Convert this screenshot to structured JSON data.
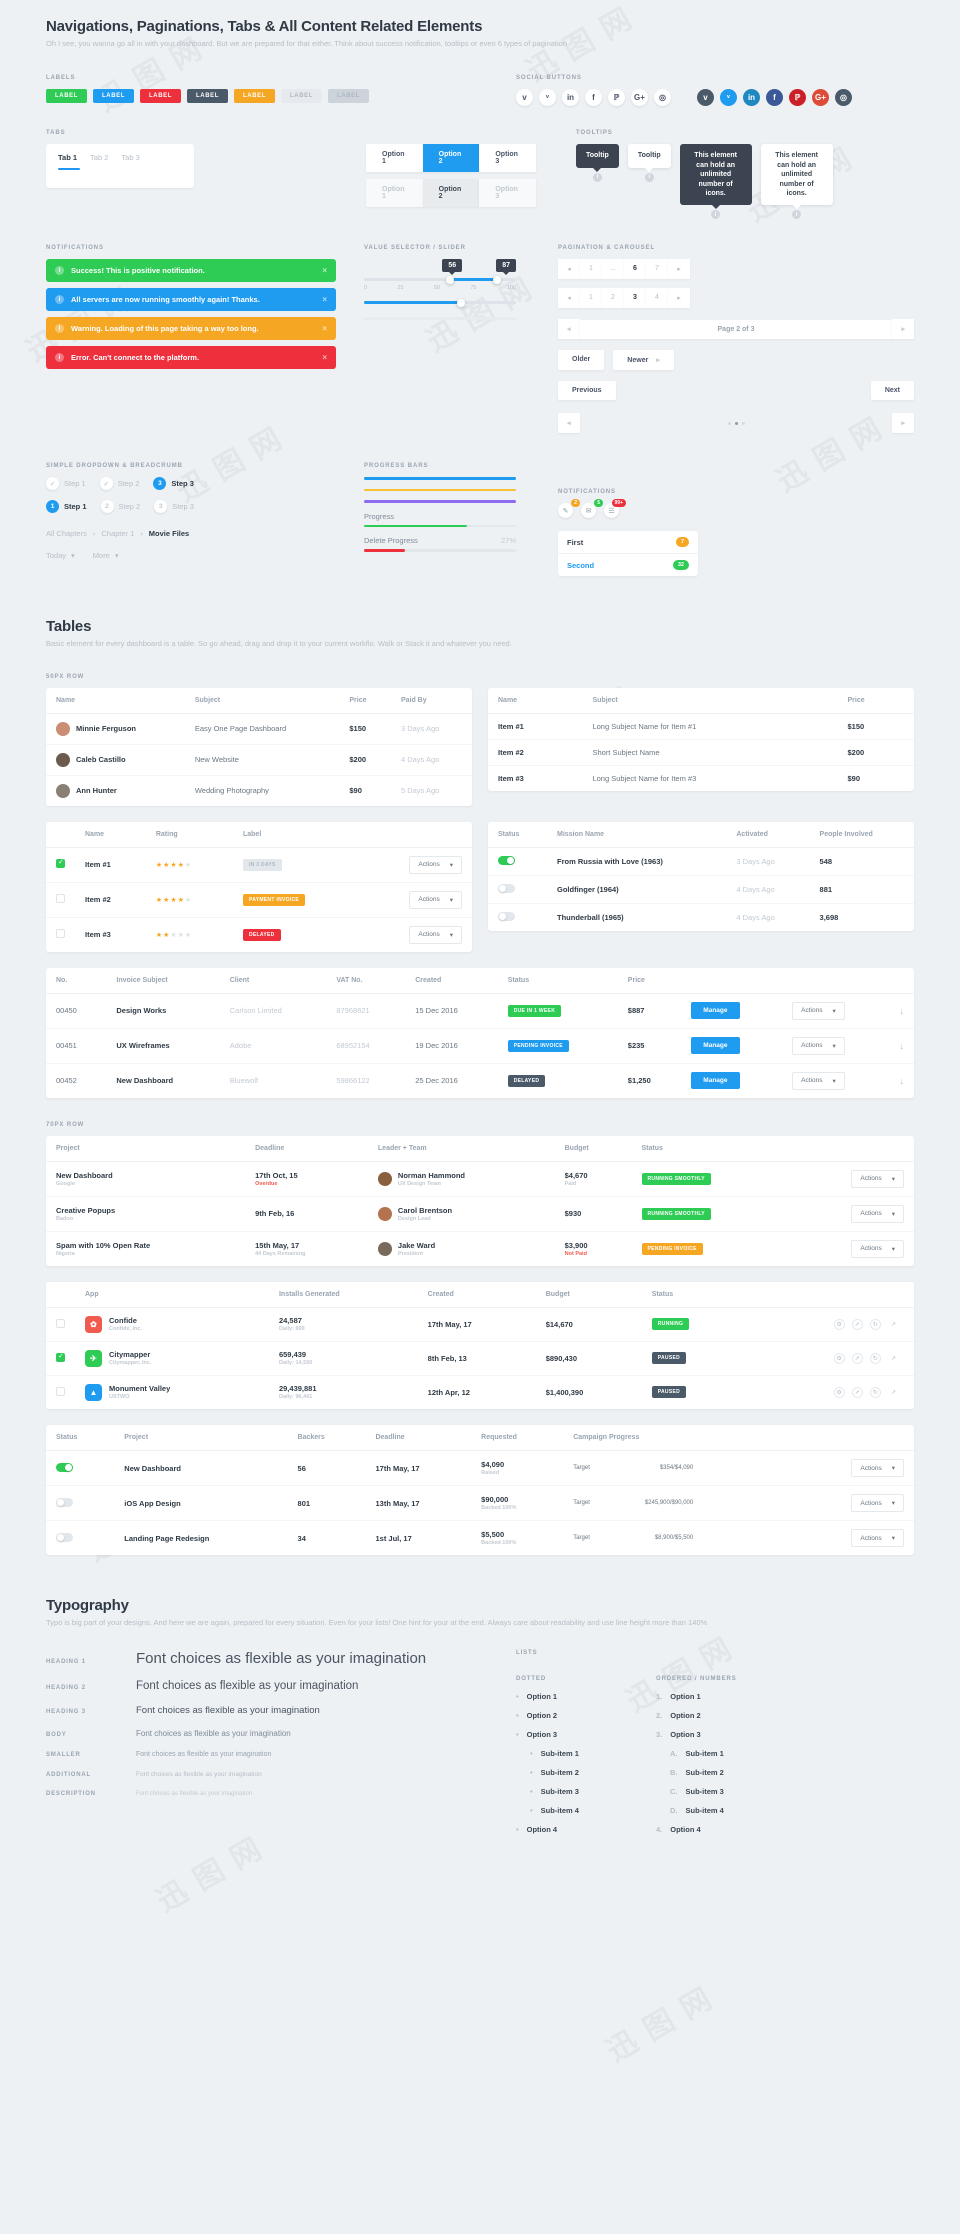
{
  "header": {
    "title": "Navigations, Paginations, Tabs & All Content Related Elements",
    "subtitle": "Oh I see, you wanna go all in with your dashboard. But we are prepared for that either. Think about success notification, tooltips or even 6 types of pagination"
  },
  "labels": {
    "caption": "LABELS",
    "items": [
      {
        "text": "LABEL",
        "color": "#2ecc55"
      },
      {
        "text": "LABEL",
        "color": "#1f9bf0"
      },
      {
        "text": "LABEL",
        "color": "#ee2f3c"
      },
      {
        "text": "LABEL",
        "color": "#4b5a69"
      },
      {
        "text": "LABEL",
        "color": "#f5a623"
      },
      {
        "text": "LABEL",
        "color": "#e6eaee"
      },
      {
        "text": "LABEL",
        "color": "#ccd3da"
      }
    ]
  },
  "social": {
    "caption": "SOCIAL BUTTONS",
    "light": [
      {
        "name": "vimeo-icon",
        "glyph": "v"
      },
      {
        "name": "twitter-icon",
        "glyph": "ᵛ"
      },
      {
        "name": "linkedin-icon",
        "glyph": "in"
      },
      {
        "name": "facebook-icon",
        "glyph": "f"
      },
      {
        "name": "pinterest-icon",
        "glyph": "ℙ"
      },
      {
        "name": "googleplus-icon",
        "glyph": "G+"
      },
      {
        "name": "instagram-icon",
        "glyph": "◎"
      }
    ],
    "dark": [
      {
        "name": "vimeo-icon",
        "glyph": "v",
        "color": "#4b5a69"
      },
      {
        "name": "twitter-icon",
        "glyph": "ᵛ",
        "color": "#1f9bf0"
      },
      {
        "name": "linkedin-icon",
        "glyph": "in",
        "color": "#1f88c0"
      },
      {
        "name": "facebook-icon",
        "glyph": "f",
        "color": "#3b5998"
      },
      {
        "name": "pinterest-icon",
        "glyph": "ℙ",
        "color": "#cb2027"
      },
      {
        "name": "googleplus-icon",
        "glyph": "G+",
        "color": "#dd4b39"
      },
      {
        "name": "instagram-icon",
        "glyph": "◎",
        "color": "#4b5a69"
      }
    ]
  },
  "tabs": {
    "caption": "TABS",
    "items": [
      {
        "label": "Tab 1",
        "active": true
      },
      {
        "label": "Tab 2",
        "active": false
      },
      {
        "label": "Tab 3",
        "active": false
      }
    ],
    "segments_top": [
      {
        "label": "Option 1",
        "state": "normal"
      },
      {
        "label": "Option 2",
        "state": "active"
      },
      {
        "label": "Option 3",
        "state": "normal"
      }
    ],
    "segments_bottom": [
      {
        "label": "Option 1",
        "state": "muted"
      },
      {
        "label": "Option 2",
        "state": "greyactive"
      },
      {
        "label": "Option 3",
        "state": "muted"
      }
    ]
  },
  "tooltips": {
    "caption": "TOOLTIPS",
    "items": [
      {
        "text": "Tooltip",
        "style": "dark"
      },
      {
        "text": "Tooltip",
        "style": "light"
      },
      {
        "text": "This element can hold an unlimited number of icons.",
        "style": "dark"
      },
      {
        "text": "This element can hold an unlimited number of icons.",
        "style": "light"
      }
    ]
  },
  "notifications": {
    "caption": "NOTIFICATIONS",
    "items": [
      {
        "text": "Success! This is positive notification.",
        "color": "#2ecc55"
      },
      {
        "text": "All servers are now running smoothly again! Thanks.",
        "color": "#1f9bf0"
      },
      {
        "text": "Warning. Loading of this page taking a way too long.",
        "color": "#f5a623"
      },
      {
        "text": "Error. Can't connect to the platform.",
        "color": "#ee2f3c"
      }
    ]
  },
  "slider": {
    "caption": "VALUE SELECTOR / SLIDER",
    "value_a": "56",
    "value_b": "87",
    "ticks": [
      "0",
      "25",
      "50",
      "75",
      "100"
    ],
    "bottom_value_percent": 64
  },
  "pagination": {
    "caption": "PAGINATION & CAROUSEL",
    "row1": [
      "◂",
      "1",
      "...",
      "6",
      "7",
      "▸"
    ],
    "row1_active": "6",
    "row2": [
      "◂",
      "1",
      "2",
      "3",
      "4",
      "▸"
    ],
    "row2_active": "3",
    "page_of": "Page 2 of 3",
    "older": "Older",
    "newer": "Newer",
    "previous": "Previous",
    "next": "Next"
  },
  "dropdown": {
    "caption": "SIMPLE DROPDOWN & BREADCRUMB",
    "steps_top": [
      {
        "mark": "✓",
        "label": "Step 1",
        "active": false
      },
      {
        "mark": "✓",
        "label": "Step 2",
        "active": false
      },
      {
        "mark": "3",
        "label": "Step 3",
        "active": true
      }
    ],
    "steps_bottom": [
      {
        "mark": "1",
        "label": "Step 1",
        "active": true
      },
      {
        "mark": "2",
        "label": "Step 2",
        "active": false
      },
      {
        "mark": "3",
        "label": "Step 3",
        "active": false
      }
    ],
    "breadcrumb": [
      "All Chapters",
      "Chapter 1",
      "Movie Files"
    ],
    "selects": [
      "Today",
      "More"
    ]
  },
  "progress": {
    "caption": "PROGRESS BARS",
    "bars": [
      {
        "color": "#1f9bf0",
        "percent": 100
      },
      {
        "color": "#f5c234",
        "percent": 100
      },
      {
        "color": "#8e6bf0",
        "percent": 100
      }
    ],
    "items": [
      {
        "label": "Progress",
        "value": "",
        "color": "#2ecc55",
        "percent": 68
      },
      {
        "label": "Delete Progress",
        "value": "27%",
        "color": "#ee2f3c",
        "percent": 27
      }
    ]
  },
  "notif_list": {
    "caption": "NOTIFICATIONS",
    "badges": [
      {
        "icon": "✎",
        "count": "2",
        "color": "#f5a623"
      },
      {
        "icon": "✉",
        "count": "5",
        "color": "#2ecc55"
      },
      {
        "icon": "☰",
        "count": "99+",
        "color": "#ee2f3c"
      }
    ],
    "rows": [
      {
        "label": "First",
        "color": "#3d4852",
        "badge": "7",
        "badge_color": "#f5a623"
      },
      {
        "label": "Second",
        "color": "#1f9bf0",
        "badge": "32",
        "badge_color": "#2ecc55"
      }
    ]
  },
  "tables": {
    "title": "Tables",
    "subtitle": "Basic element for every dashboard is a table. So go ahead, drag and drop it to your current workflo. Walk or Stack it and whatever you need.",
    "caption_50": "50PX ROW",
    "caption_70": "70PX ROW",
    "t1": {
      "headers": [
        "Name",
        "Subject",
        "Price",
        "Paid By"
      ],
      "rows": [
        {
          "avatar": "#c98e74",
          "name": "Minnie Ferguson",
          "subject": "Easy One Page Dashboard",
          "price": "$150",
          "paid": "3 Days Ago"
        },
        {
          "avatar": "#6b5b4f",
          "name": "Caleb Castillo",
          "subject": "New Website",
          "price": "$200",
          "paid": "4 Days Ago"
        },
        {
          "avatar": "#8a7f75",
          "name": "Ann Hunter",
          "subject": "Wedding Photography",
          "price": "$90",
          "paid": "5 Days Ago"
        }
      ]
    },
    "t2": {
      "headers": [
        "Name",
        "Subject",
        "Price"
      ],
      "rows": [
        {
          "name": "Item #1",
          "subject": "Long Subject Name for Item #1",
          "price": "$150"
        },
        {
          "name": "Item #2",
          "subject": "Short Subject Name",
          "price": "$200"
        },
        {
          "name": "Item #3",
          "subject": "Long Subject Name for Item #3",
          "price": "$90"
        }
      ]
    },
    "t3": {
      "headers": [
        "",
        "Name",
        "Rating",
        "Label",
        ""
      ],
      "rows": [
        {
          "checked": true,
          "name": "Item #1",
          "stars": 4,
          "label": "IN 3 DAYS",
          "label_color": "#e2e7ec",
          "action": "Actions"
        },
        {
          "checked": false,
          "name": "Item #2",
          "stars": 4,
          "label": "PAYMENT INVOICE",
          "label_color": "#f5a623",
          "action": "Actions"
        },
        {
          "checked": false,
          "name": "Item #3",
          "stars": 2,
          "label": "DELAYED",
          "label_color": "#ee2f3c",
          "action": "Actions"
        }
      ]
    },
    "t4": {
      "headers": [
        "Status",
        "Mission Name",
        "Activated",
        "People Involved"
      ],
      "rows": [
        {
          "on": true,
          "mission": "From Russia with Love (1963)",
          "activated": "3 Days Ago",
          "people": "548"
        },
        {
          "on": false,
          "mission": "Goldfinger (1964)",
          "activated": "4 Days Ago",
          "people": "881"
        },
        {
          "on": false,
          "mission": "Thunderball (1965)",
          "activated": "4 Days Ago",
          "people": "3,698"
        }
      ]
    },
    "t5": {
      "headers": [
        "No.",
        "Invoice Subject",
        "Client",
        "VAT No.",
        "Created",
        "Status",
        "Price",
        "",
        "",
        ""
      ],
      "rows": [
        {
          "no": "00450",
          "subject": "Design Works",
          "client": "Carlson Limited",
          "vat": "87968621",
          "created": "15 Dec 2016",
          "status": "DUE IN 1 WEEK",
          "status_color": "#2ecc55",
          "price": "$887",
          "manage": "Manage",
          "action": "Actions"
        },
        {
          "no": "00451",
          "subject": "UX Wireframes",
          "client": "Adobe",
          "vat": "68952154",
          "created": "19 Dec 2016",
          "status": "PENDING INVOICE",
          "status_color": "#1f9bf0",
          "price": "$235",
          "manage": "Manage",
          "action": "Actions"
        },
        {
          "no": "00452",
          "subject": "New Dashboard",
          "client": "Bluewolf",
          "vat": "59866122",
          "created": "25 Dec 2016",
          "status": "DELAYED",
          "status_color": "#4b5a69",
          "price": "$1,250",
          "manage": "Manage",
          "action": "Actions"
        }
      ]
    },
    "t6": {
      "headers": [
        "Project",
        "Deadline",
        "Leader + Team",
        "Budget",
        "Status",
        ""
      ],
      "rows": [
        {
          "project": "New Dashboard",
          "project_sub": "Google",
          "deadline": "17th Oct, 15",
          "deadline_sub": "Overdue",
          "deadline_warn": true,
          "avatar": "#8a5f3d",
          "leader": "Norman Hammond",
          "leader_sub": "UX Design Team",
          "budget": "$4,670",
          "budget_sub": "Paid",
          "status": "RUNNING SMOOTHLY",
          "status_color": "#2ecc55",
          "action": "Actions"
        },
        {
          "project": "Creative Popups",
          "project_sub": "Badoo",
          "deadline": "9th Feb, 16",
          "deadline_sub": "",
          "avatar": "#b5724f",
          "leader": "Carol Brentson",
          "leader_sub": "Design Lead",
          "budget": "$930",
          "budget_sub": "",
          "status": "RUNNING SMOOTHLY",
          "status_color": "#2ecc55",
          "action": "Actions"
        },
        {
          "project": "Spam with 10% Open Rate",
          "project_sub": "Nigeria",
          "deadline": "15th May, 17",
          "deadline_sub": "44 Days Remaining",
          "avatar": "#7a6a5c",
          "leader": "Jake Ward",
          "leader_sub": "President",
          "budget": "$3,900",
          "budget_sub": "Not Paid",
          "budget_warn": true,
          "status": "PENDING INVOICE",
          "status_color": "#f5a623",
          "action": "Actions"
        }
      ]
    },
    "t7": {
      "headers": [
        "",
        "App",
        "Installs Generated",
        "Created",
        "Budget",
        "Status",
        ""
      ],
      "rows": [
        {
          "checked": false,
          "icon_color": "#f05b4f",
          "icon": "✿",
          "app": "Confide",
          "app_sub": "Confide, inc.",
          "installs": "24,587",
          "installs_sub": "Daily: 690",
          "created": "17th May, 17",
          "budget": "$14,670",
          "status": "RUNNING",
          "status_color": "#2ecc55"
        },
        {
          "checked": true,
          "icon_color": "#2ecc55",
          "icon": "✈",
          "app": "Citymapper",
          "app_sub": "Citymapper, Inc.",
          "installs": "659,439",
          "installs_sub": "Daily: 14,590",
          "created": "8th Feb, 13",
          "budget": "$890,430",
          "status": "PAUSED",
          "status_color": "#4b5a69"
        },
        {
          "checked": false,
          "icon_color": "#1f9bf0",
          "icon": "▲",
          "app": "Monument Valley",
          "app_sub": "USTWO",
          "installs": "29,439,881",
          "installs_sub": "Daily: 96,441",
          "created": "12th Apr, 12",
          "budget": "$1,400,390",
          "status": "PAUSED",
          "status_color": "#4b5a69"
        }
      ]
    },
    "t8": {
      "headers": [
        "Status",
        "Project",
        "Backers",
        "Deadline",
        "Requested",
        "Campaign Progress",
        ""
      ],
      "rows": [
        {
          "on": true,
          "project": "New Dashboard",
          "backers": "56",
          "deadline": "17th May, 17",
          "requested": "$4,090",
          "requested_sub": "Raised",
          "target_label": "Target",
          "target_value": "$354/$4,090",
          "percent": 9,
          "action": "Actions"
        },
        {
          "on": false,
          "project": "iOS App Design",
          "backers": "801",
          "deadline": "13th May, 17",
          "requested": "$90,000",
          "requested_sub": "Backed 100%",
          "target_label": "Target",
          "target_value": "$245,900/$90,000",
          "percent": 100,
          "action": "Actions"
        },
        {
          "on": false,
          "project": "Landing Page Redesign",
          "backers": "34",
          "deadline": "1st Jul, 17",
          "requested": "$5,500",
          "requested_sub": "Backed 100%",
          "target_label": "Target",
          "target_value": "$8,900/$5,500",
          "percent": 100,
          "action": "Actions"
        }
      ]
    }
  },
  "typography": {
    "title": "Typography",
    "subtitle": "Typo is big part of your designs. And here we are again, prepared for every situation. Even for your lists! One hint for your at the end. Always care about readability and use line height more than 140%",
    "rows": [
      {
        "key": "HEADING 1",
        "text": "Font choices as flexible as your imagination",
        "cls": "h1t"
      },
      {
        "key": "HEADING 2",
        "text": "Font choices as flexible as your imagination",
        "cls": "h2t"
      },
      {
        "key": "HEADING 3",
        "text": "Font choices as flexible as your imagination",
        "cls": "h3t"
      },
      {
        "key": "BODY",
        "text": "Font choices as flexible as your imagination",
        "cls": "bodyt"
      },
      {
        "key": "SMALLER",
        "text": "Font choices as flexible as your imagination",
        "cls": "smallt"
      },
      {
        "key": "ADDITIONAL",
        "text": "Font choices as flexible as your imagination",
        "cls": "addt"
      },
      {
        "key": "DESCRIPTION",
        "text": "Font choices as flexible as your imagination",
        "cls": "desct"
      }
    ],
    "lists_caption": "LISTS",
    "dotted_caption": "DOTTED",
    "ordered_caption": "ORDERED / NUMBERS",
    "dotted": [
      "Option 1",
      "Option 2",
      "Option 3"
    ],
    "dotted_sub": [
      "Sub-item 1",
      "Sub-item 2",
      "Sub-item 3",
      "Sub-item 4"
    ],
    "dotted_last": "Option 4",
    "ordered": [
      {
        "n": "1.",
        "t": "Option 1"
      },
      {
        "n": "2.",
        "t": "Option 2"
      },
      {
        "n": "3.",
        "t": "Option 3"
      }
    ],
    "ordered_sub": [
      {
        "n": "A.",
        "t": "Sub-item 1"
      },
      {
        "n": "B.",
        "t": "Sub-item 2"
      },
      {
        "n": "C.",
        "t": "Sub-item 3"
      },
      {
        "n": "D.",
        "t": "Sub-item 4"
      }
    ],
    "ordered_last": {
      "n": "4.",
      "t": "Option 4"
    }
  }
}
